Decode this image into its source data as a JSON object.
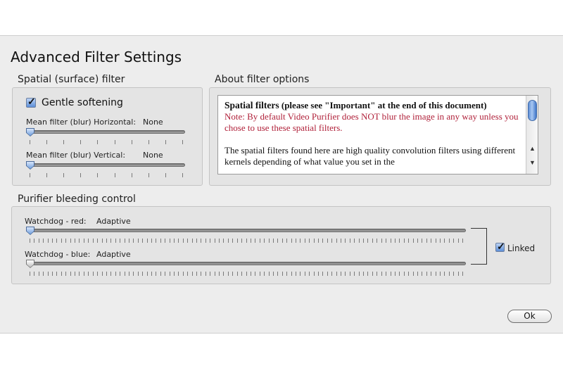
{
  "window": {
    "title": "Advanced Filter Settings"
  },
  "spatial": {
    "group_label": "Spatial (surface) filter",
    "gentle_softening": {
      "label": "Gentle softening",
      "checked": true
    },
    "mean_horizontal": {
      "label": "Mean filter (blur) Horizontal:",
      "value": "None",
      "level": 0
    },
    "mean_vertical": {
      "label": "Mean filter (blur) Vertical:",
      "value": "None",
      "level": 0
    }
  },
  "about": {
    "group_label": "About filter options",
    "heading_main": "Spatial filters",
    "heading_rest": " (please see \"Important\" at the end of this document)",
    "note": "Note: By default Video Purifier does NOT blur the image in any way unless you chose to use these spatial filters.",
    "paragraph": "The spatial filters found here are high quality convolution filters using different kernels depending of what value you set in the",
    "scroll_up_icon": "triangle-up",
    "scroll_down_icon": "triangle-down"
  },
  "bleeding": {
    "group_label": "Purifier bleeding control",
    "watchdog_red": {
      "label": "Watchdog - red:",
      "value": "Adaptive",
      "level": 0
    },
    "watchdog_blue": {
      "label": "Watchdog - blue:",
      "value": "Adaptive",
      "level": 0
    },
    "linked": {
      "label": "Linked",
      "checked": true
    }
  },
  "buttons": {
    "ok": "Ok"
  },
  "colors": {
    "note_text": "#b0213a",
    "accent_blue": "#5d8fd8"
  }
}
